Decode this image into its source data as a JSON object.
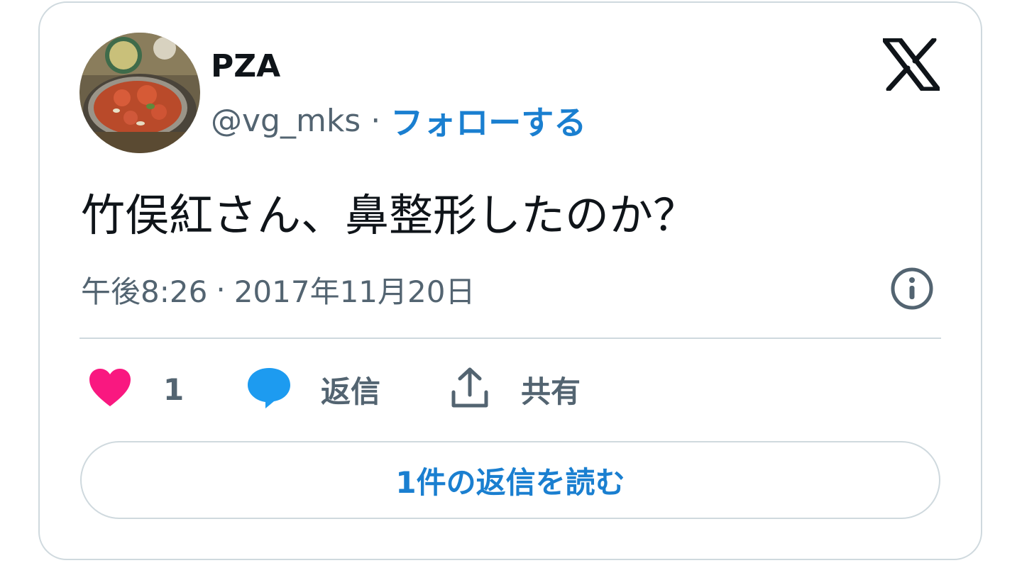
{
  "author": {
    "display_name": "PZA",
    "handle": "@vg_mks",
    "separator": "·",
    "follow_label": "フォローする"
  },
  "tweet": {
    "text": "竹俣紅さん、鼻整形したのか？",
    "time": "午後8:26",
    "date_separator": "·",
    "date": "2017年11月20日"
  },
  "actions": {
    "like_count": "1",
    "reply_label": "返信",
    "share_label": "共有"
  },
  "read_replies_label": "1件の返信を読む",
  "colors": {
    "text_primary": "#0f1419",
    "text_secondary": "#536471",
    "link_blue": "#1a7fd0",
    "heart_pink": "#f91880",
    "reply_blue": "#1d9bf0",
    "border": "#cfd9de"
  },
  "icons": {
    "brand": "x-logo-icon",
    "info": "info-icon",
    "like": "heart-icon",
    "reply": "speech-bubble-icon",
    "share": "share-upload-icon"
  }
}
